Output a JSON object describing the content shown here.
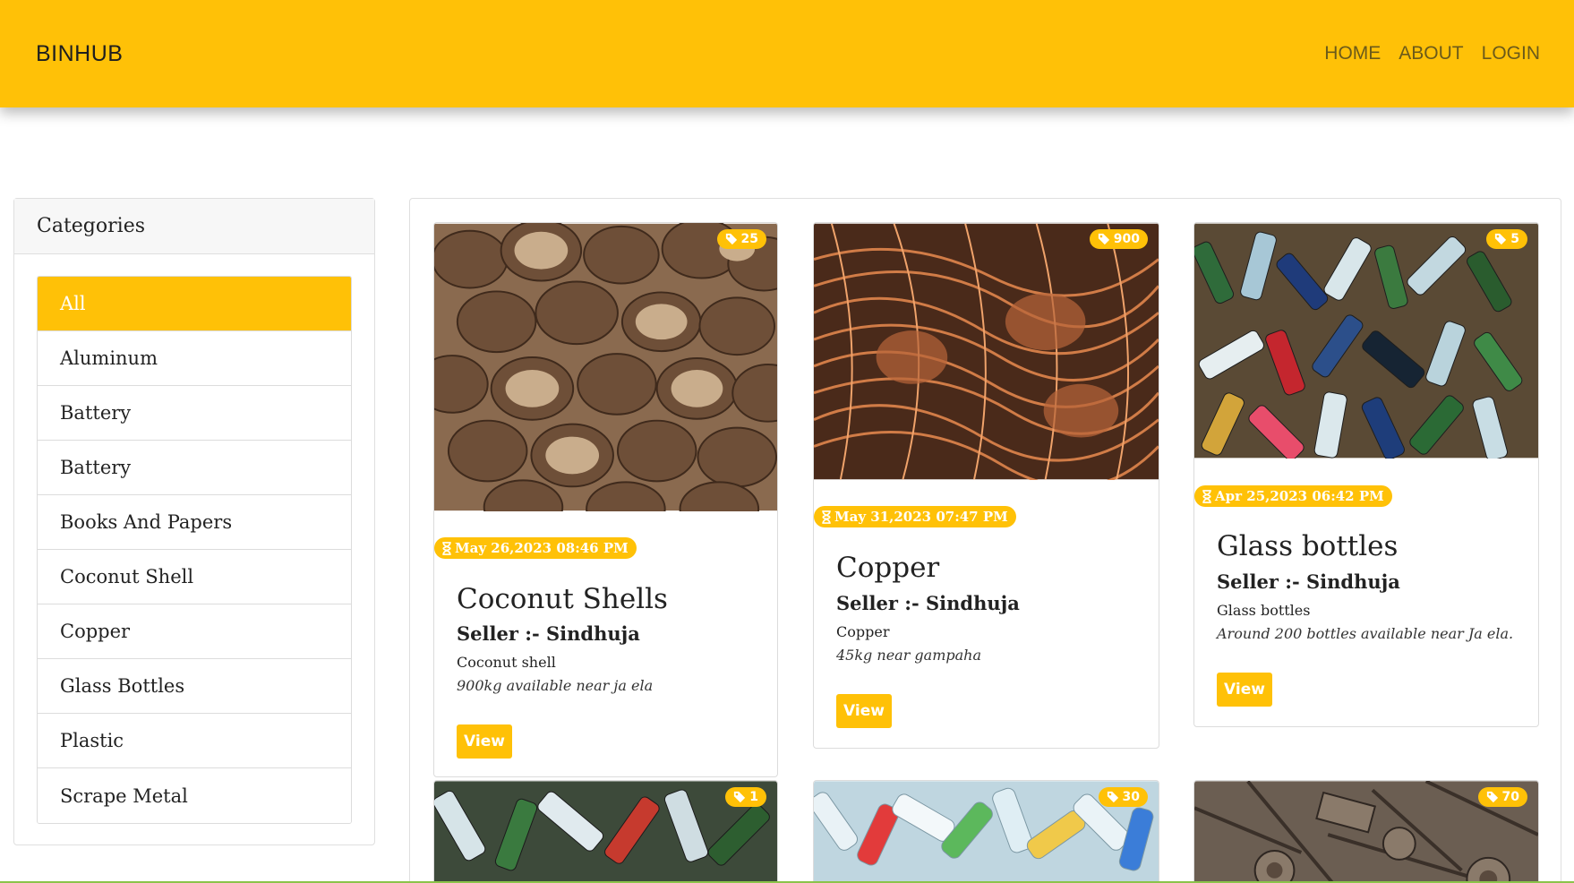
{
  "navbar": {
    "brand": "BINHUB",
    "links": [
      "HOME",
      "ABOUT",
      "LOGIN"
    ]
  },
  "sidebar": {
    "title": "Categories",
    "items": [
      {
        "label": "All",
        "active": true
      },
      {
        "label": "Aluminum"
      },
      {
        "label": "Battery"
      },
      {
        "label": "Battery"
      },
      {
        "label": "Books And Papers"
      },
      {
        "label": "Coconut Shell"
      },
      {
        "label": "Copper"
      },
      {
        "label": "Glass Bottles"
      },
      {
        "label": "Plastic"
      },
      {
        "label": "Scrape Metal"
      }
    ]
  },
  "products": [
    {
      "title": "Coconut Shells",
      "quantity": "25",
      "date": "May 26,2023 08:46 PM",
      "seller": "Seller :- Sindhuja",
      "category": "Coconut shell",
      "description": "900kg available near ja ela",
      "button": "View",
      "image": "coconut-shells-photo"
    },
    {
      "title": "Copper",
      "quantity": "900",
      "date": "May 31,2023 07:47 PM",
      "seller": "Seller :- Sindhuja",
      "category": "Copper",
      "description": "45kg near gampaha",
      "button": "View",
      "image": "copper-wire-photo"
    },
    {
      "title": "Glass bottles",
      "quantity": "5",
      "date": "Apr 25,2023 06:42 PM",
      "seller": "Seller :- Sindhuja",
      "category": "Glass bottles",
      "description": "Around 200 bottles available near Ja ela.",
      "button": "View",
      "image": "glass-bottles-photo"
    },
    {
      "quantity": "1",
      "image": "glass-bottles-photo"
    },
    {
      "quantity": "30",
      "image": "plastic-bottles-photo"
    },
    {
      "quantity": "70",
      "image": "scrap-metal-photo"
    }
  ],
  "colors": {
    "accent": "#ffc107",
    "text": "#212529",
    "border": "#dcdcdc"
  }
}
